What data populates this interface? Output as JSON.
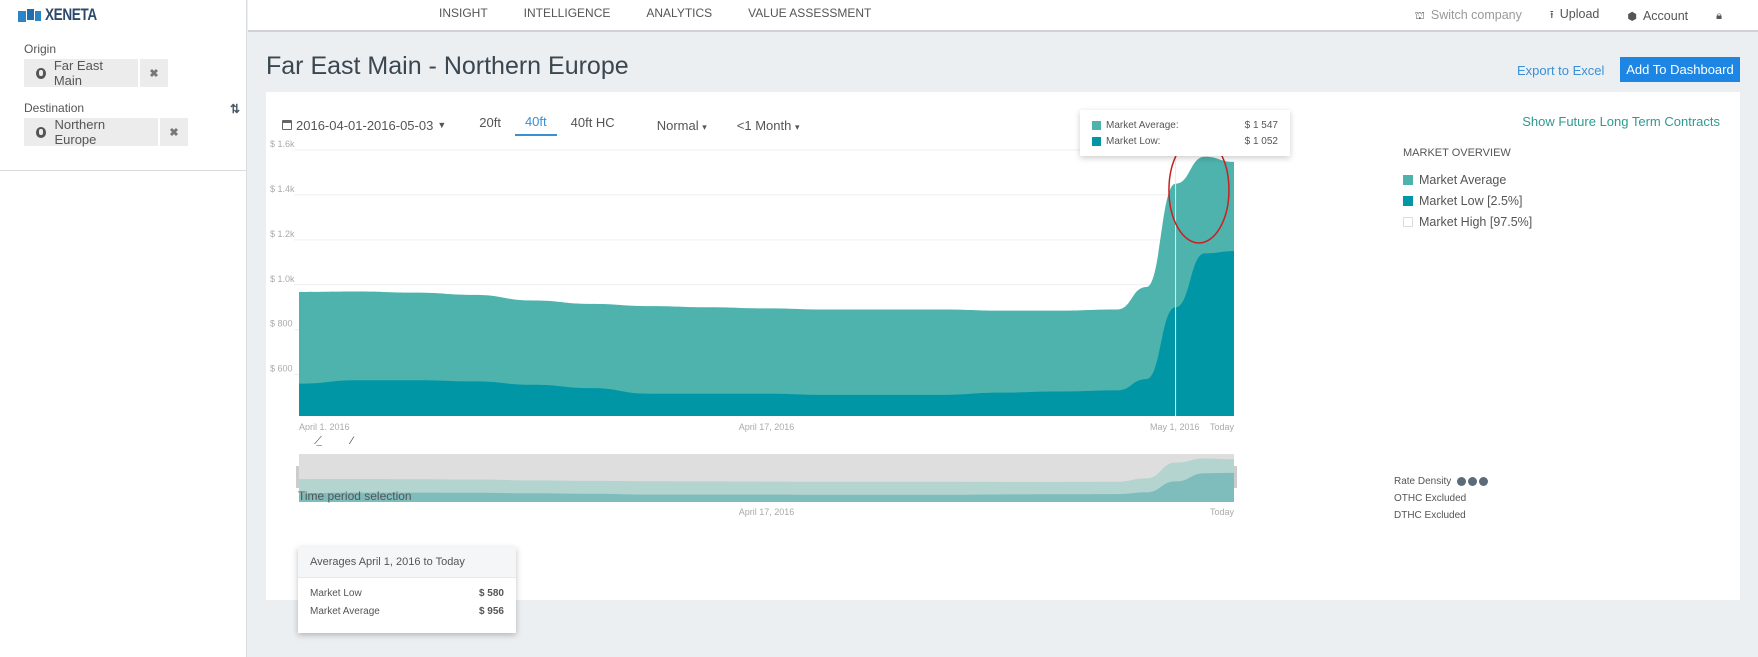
{
  "brand": {
    "name": "XENETA"
  },
  "sidebar": {
    "origin_label": "Origin",
    "origin_value": "Far East Main",
    "destination_label": "Destination",
    "destination_value": "Northern Europe",
    "remove_symbol": "✖",
    "swap_symbol": "⇅"
  },
  "topnav": {
    "items": [
      {
        "label": "INSIGHT"
      },
      {
        "label": "INTELLIGENCE"
      },
      {
        "label": "ANALYTICS"
      },
      {
        "label": "VALUE ASSESSMENT"
      }
    ],
    "right": {
      "switch_company": "Switch company",
      "upload": "Upload",
      "account": "Account"
    }
  },
  "page": {
    "title": "Far East Main - Northern Europe",
    "export_label": "Export to Excel",
    "add_dashboard_label": "Add To Dashboard"
  },
  "toolbar": {
    "date_range": "2016-04-01-2016-05-03",
    "tabs": [
      {
        "label": "20ft",
        "active": false
      },
      {
        "label": "40ft",
        "active": true
      },
      {
        "label": "40ft HC",
        "active": false
      }
    ],
    "mode": "Normal",
    "period": "<1 Month",
    "future_link": "Show Future Long Term Contracts"
  },
  "tooltip": {
    "rows": [
      {
        "label": "Market Average:",
        "value": "$ 1 547"
      },
      {
        "label": "Market Low:",
        "value": "$ 1 052"
      }
    ]
  },
  "legend": {
    "title": "MARKET OVERVIEW",
    "items": [
      {
        "label": "Market Average",
        "color": "#4db3ac"
      },
      {
        "label": "Market Low [2.5%]",
        "color": "#0096a6"
      },
      {
        "label": "Market High [97.5%]",
        "color": "#ffffff"
      }
    ]
  },
  "side_info": {
    "rate_density": "Rate Density",
    "othc": "OTHC Excluded",
    "dthc": "DTHC Excluded"
  },
  "period_selection": {
    "label": "Time period selection",
    "averages_title": "Averages April 1, 2016 to Today",
    "rows": [
      {
        "label": "Market Low",
        "value": "$ 580"
      },
      {
        "label": "Market Average",
        "value": "$ 956"
      }
    ]
  },
  "colors": {
    "average": "#4db3ac",
    "low": "#0096a6",
    "accent": "#1d85e3",
    "highlight": "#cc1f1f"
  },
  "chart_data": {
    "type": "area",
    "title": "Far East Main - Northern Europe",
    "xlabel": "",
    "ylabel": "",
    "y_ticks": [
      600,
      800,
      1000,
      1200,
      1400,
      1600
    ],
    "y_tick_labels": [
      "$ 600",
      "$ 800",
      "$ 1.0k",
      "$ 1.2k",
      "$ 1.4k",
      "$ 1.6k"
    ],
    "ylim": [
      416,
      1600
    ],
    "x_tick_labels": [
      "April 1, 2016",
      "April 17, 2016",
      "May 1, 2016",
      "Today"
    ],
    "x_tick_positions": [
      0,
      16,
      30,
      32
    ],
    "x_range": [
      0,
      32
    ],
    "grid": true,
    "legend_position": "right",
    "x": [
      0,
      2,
      4,
      6,
      8,
      10,
      12,
      14,
      16,
      18,
      20,
      22,
      24,
      26,
      28,
      29,
      30,
      31,
      32
    ],
    "series": [
      {
        "name": "Market Average",
        "values": [
          968,
          970,
          965,
          955,
          930,
          915,
          905,
          900,
          895,
          890,
          890,
          890,
          885,
          885,
          890,
          990,
          1450,
          1570,
          1547
        ]
      },
      {
        "name": "Market Low [2.5%]",
        "values": [
          560,
          575,
          575,
          570,
          555,
          540,
          515,
          515,
          515,
          510,
          510,
          510,
          520,
          525,
          530,
          580,
          900,
          1140,
          1150
        ]
      }
    ],
    "hover": {
      "x": 30,
      "label": "May 1, 2016",
      "Market Average": 1547,
      "Market Low": 1052
    },
    "navigator": {
      "x_tick_labels": [
        "April 17, 2016",
        "Today"
      ],
      "selection": "April 1, 2016 to Today"
    }
  }
}
